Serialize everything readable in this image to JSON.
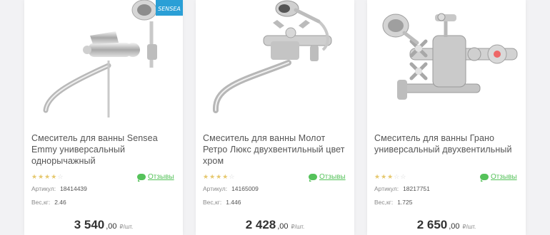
{
  "products": [
    {
      "title": "Смеситель для ванны Sensea Emmy универсальный однорычажный",
      "brand_badge": "SENSEA",
      "stars": "★★★★☆",
      "reviews_label": "Отзывы",
      "article_label": "Артикул:",
      "article_value": "18414439",
      "weight_label": "Вес,кг:",
      "weight_value": "2.46",
      "price_main": "3 540",
      "price_cents": ",00",
      "price_unit": "₽/шт."
    },
    {
      "title": "Смеситель для ванны Молот Ретро Люкс двухвентильный цвет хром",
      "stars": "★★★★☆",
      "reviews_label": "Отзывы",
      "article_label": "Артикул:",
      "article_value": "14165009",
      "weight_label": "Вес,кг:",
      "weight_value": "1.446",
      "price_main": "2 428",
      "price_cents": ",00",
      "price_unit": "₽/шт."
    },
    {
      "title": "Смеситель для ванны Грано универсальный двухвентильный",
      "stars": "★★★☆☆",
      "reviews_label": "Отзывы",
      "article_label": "Артикул:",
      "article_value": "18217751",
      "weight_label": "Вес,кг:",
      "weight_value": "1.725",
      "price_main": "2 650",
      "price_cents": ",00",
      "price_unit": "₽/шт."
    }
  ],
  "colors": {
    "accent_green": "#55c25a",
    "star_gold": "#e6c86e",
    "text": "#555555"
  }
}
